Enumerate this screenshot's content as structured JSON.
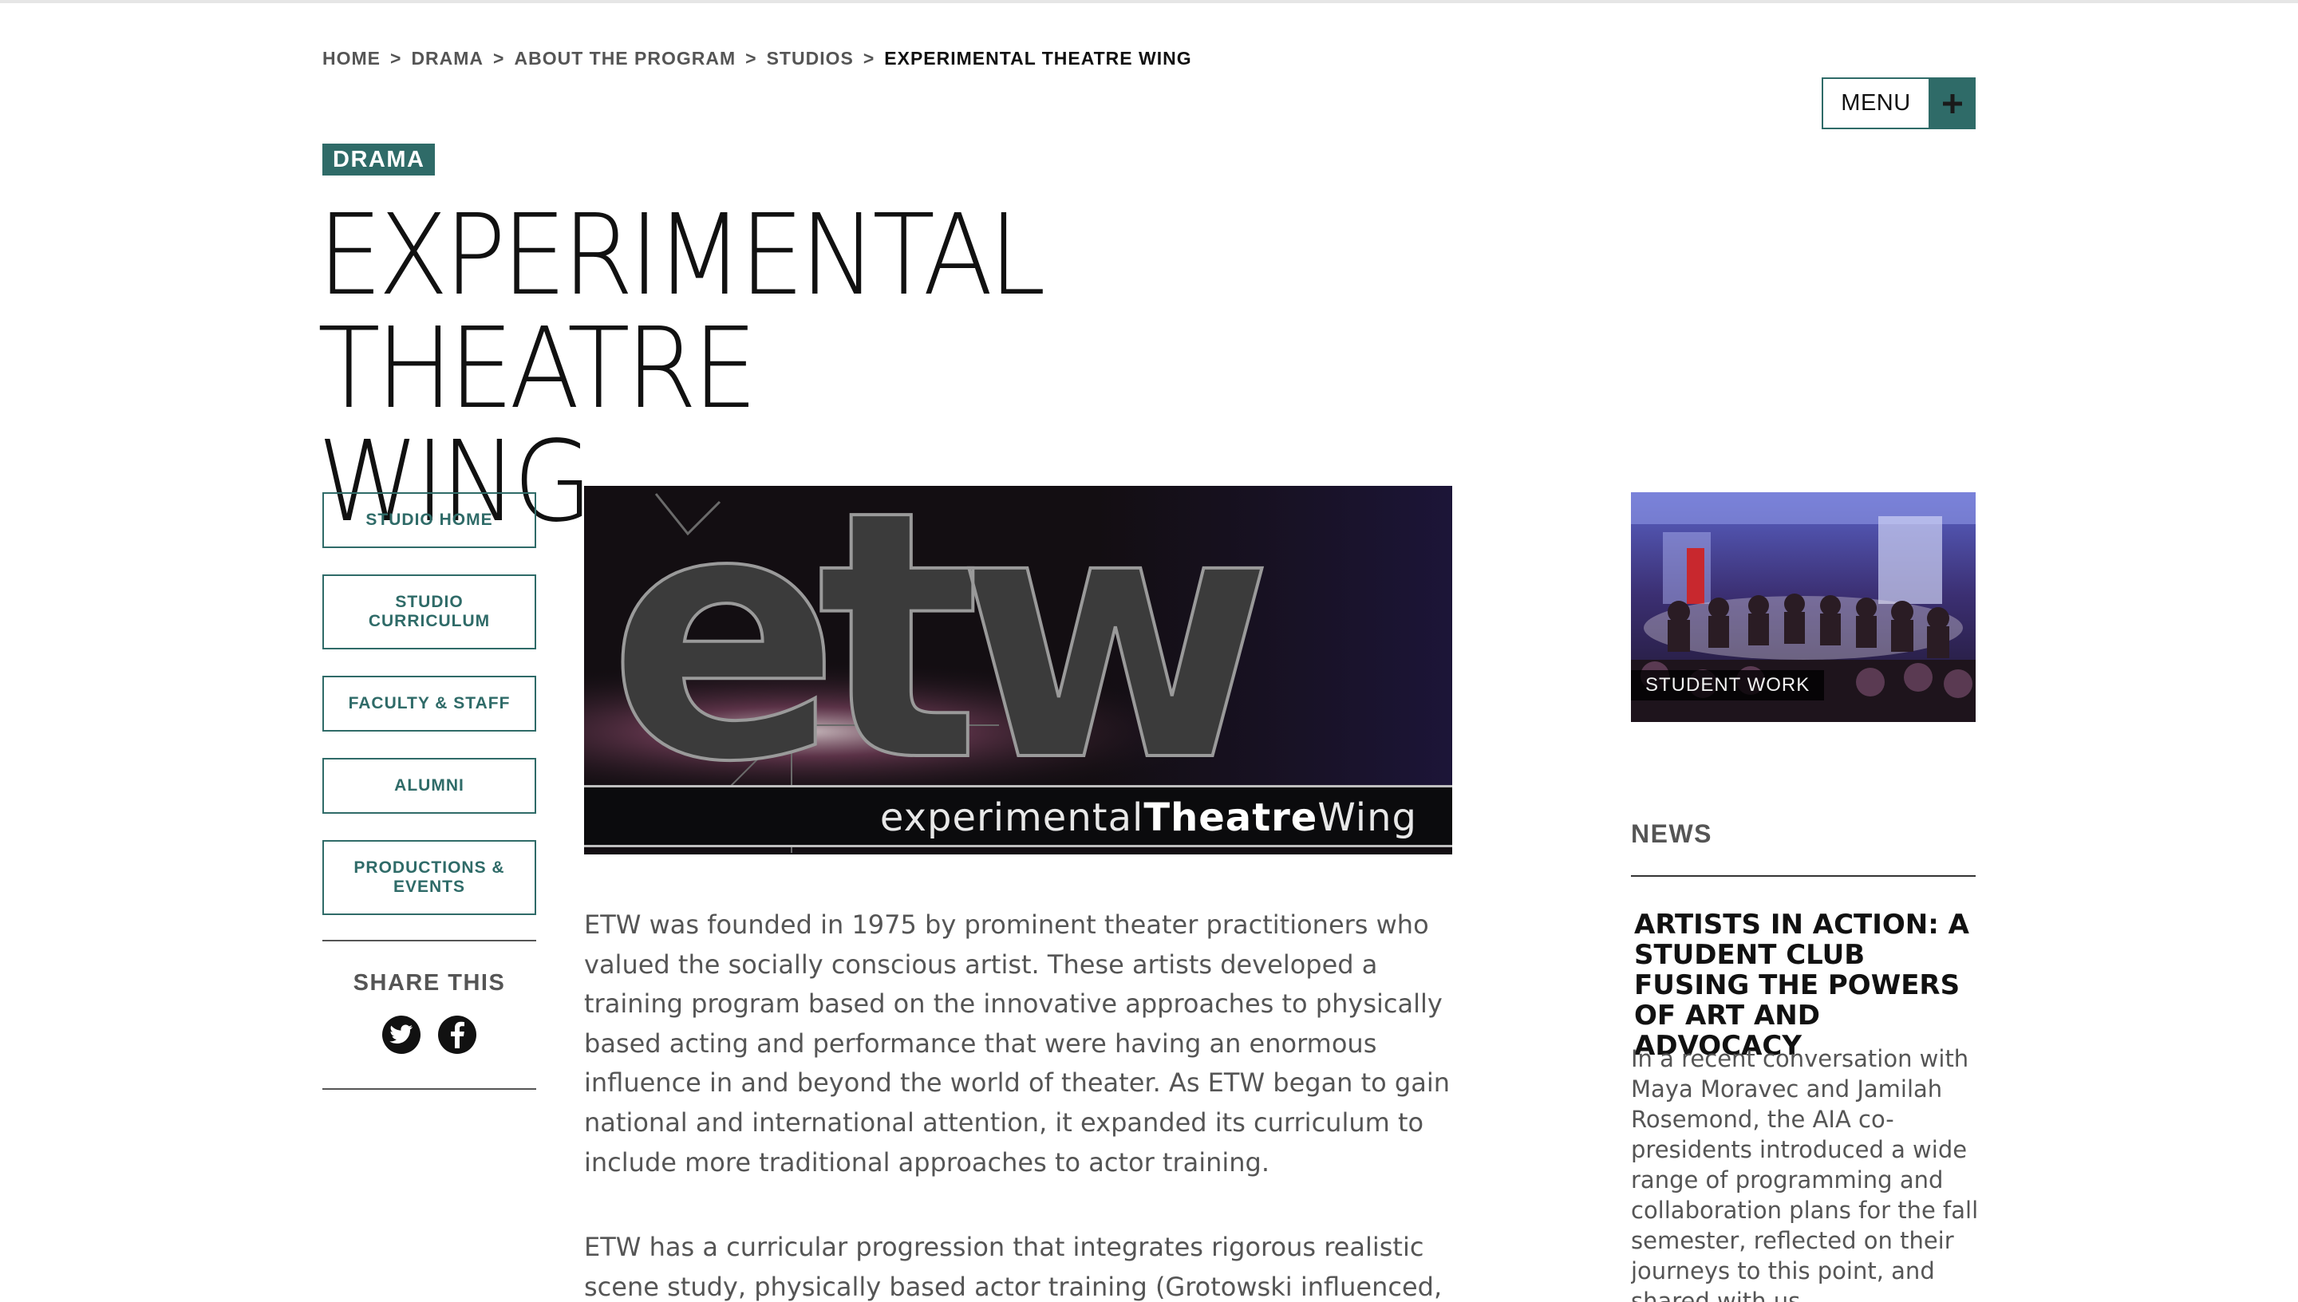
{
  "breadcrumb": {
    "items": [
      "HOME",
      "DRAMA",
      "ABOUT THE PROGRAM",
      "STUDIOS"
    ],
    "separator": ">",
    "current": "EXPERIMENTAL THEATRE WING"
  },
  "header": {
    "menu_label": "MENU",
    "menu_icon": "plus-icon",
    "tag": "DRAMA",
    "title_line1": "EXPERIMENTAL THEATRE",
    "title_line2": "WING"
  },
  "sidebar": {
    "items": [
      {
        "label": "STUDIO HOME"
      },
      {
        "label": "STUDIO CURRICULUM"
      },
      {
        "label": "FACULTY & STAFF"
      },
      {
        "label": "ALUMNI"
      },
      {
        "label": "PRODUCTIONS & EVENTS"
      }
    ],
    "share_title": "SHARE THIS",
    "share_icons": [
      "twitter-icon",
      "facebook-icon"
    ]
  },
  "hero": {
    "logo_letters": "etw",
    "caption_part1": "experimental",
    "caption_part2": "Theatre",
    "caption_part3": "Wing"
  },
  "main": {
    "paragraphs": [
      "ETW was founded in 1975 by prominent theater practitioners who valued the socially conscious artist. These artists developed a training program based on the innovative approaches to physically based acting and performance that were having an enormous influence in and beyond the world of theater. As ETW began to gain national and international attention, it expanded its curriculum to include more traditional approaches to actor training.",
      "ETW has a curricular progression that integrates rigorous realistic scene study, physically based actor training (Grotowski influenced,"
    ]
  },
  "aside": {
    "student_work_label": "STUDENT WORK",
    "news_title": "NEWS",
    "news_headline": "ARTISTS IN ACTION: A STUDENT CLUB FUSING THE POWERS OF ART AND ADVOCACY",
    "news_excerpt": "In a recent conversation with Maya Moravec and Jamilah Rosemond, the AIA co-presidents introduced a wide range of programming and collaboration plans for the fall semester, reflected on their journeys to this point, and shared with us"
  },
  "colors": {
    "accent": "#2f6b68",
    "text_muted": "#555555",
    "text_dark": "#111111"
  }
}
